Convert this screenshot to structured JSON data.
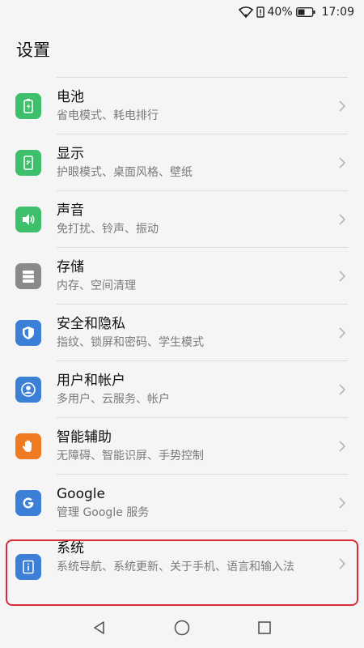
{
  "status_bar": {
    "battery": "40%",
    "time": "17:09",
    "icons": [
      "wifi-icon",
      "sim-alert-icon",
      "battery-icon"
    ]
  },
  "header": {
    "title": "设置"
  },
  "items": [
    {
      "title": "电池",
      "subtitle": "省电模式、耗电排行",
      "icon": "battery-icon",
      "color": "#3dbf6b"
    },
    {
      "title": "显示",
      "subtitle": "护眼模式、桌面风格、壁纸",
      "icon": "display-icon",
      "color": "#3dbf6b"
    },
    {
      "title": "声音",
      "subtitle": "免打扰、铃声、振动",
      "icon": "speaker-icon",
      "color": "#3dbf6b"
    },
    {
      "title": "存储",
      "subtitle": "内存、空间清理",
      "icon": "storage-icon",
      "color": "#8a8a8a"
    },
    {
      "title": "安全和隐私",
      "subtitle": "指纹、锁屏和密码、学生模式",
      "icon": "shield-icon",
      "color": "#3b7fd6"
    },
    {
      "title": "用户和帐户",
      "subtitle": "多用户、云服务、帐户",
      "icon": "user-icon",
      "color": "#3b7fd6"
    },
    {
      "title": "智能辅助",
      "subtitle": "无障碍、智能识屏、手势控制",
      "icon": "hand-icon",
      "color": "#f07a22"
    },
    {
      "title": "Google",
      "subtitle": "管理 Google 服务",
      "icon": "google-icon",
      "color": "#3b7fd6"
    },
    {
      "title": "系统",
      "subtitle": "系统导航、系统更新、关于手机、语言和输入法",
      "icon": "info-icon",
      "color": "#3b7fd6"
    }
  ],
  "nav_bar": {
    "icons": [
      "back-icon",
      "home-icon",
      "recents-icon"
    ]
  }
}
